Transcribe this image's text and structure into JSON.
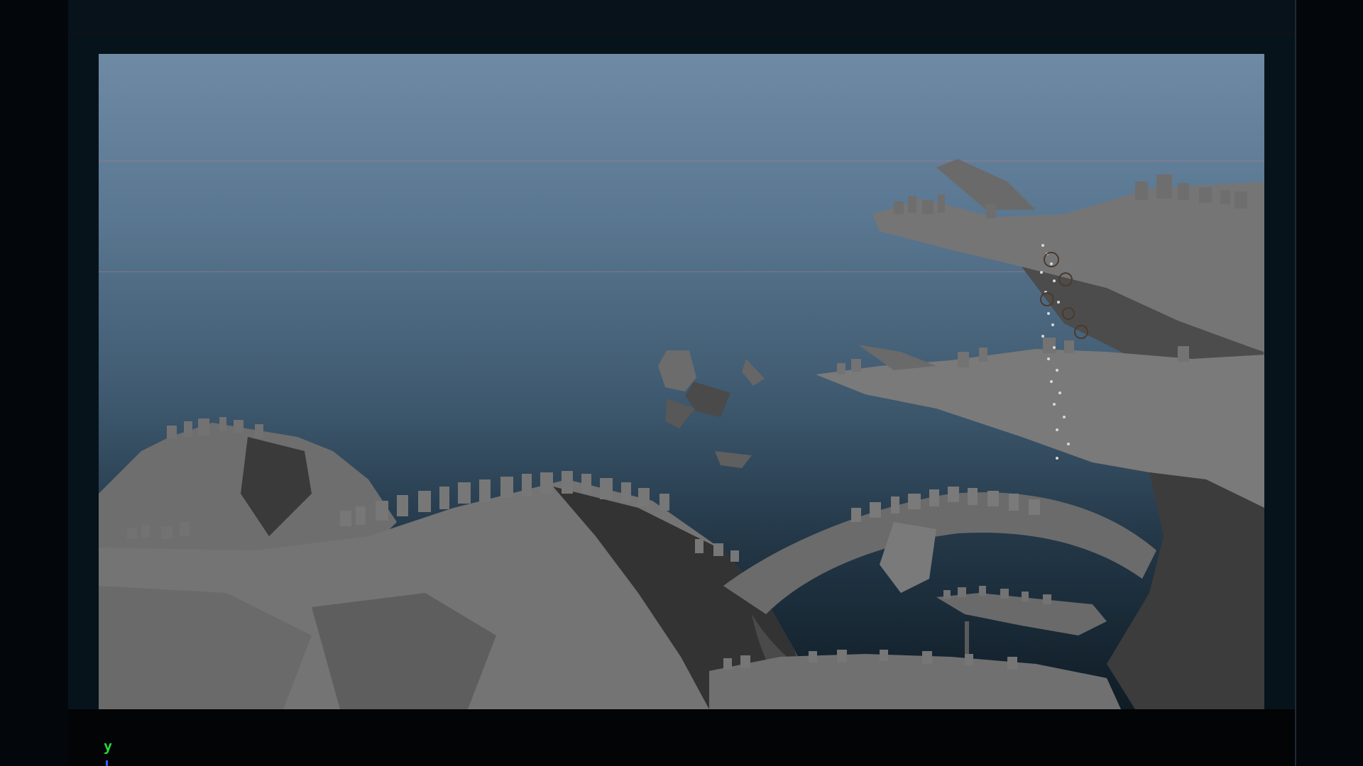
{
  "viewport": {
    "axis_labels": {
      "y": "y"
    },
    "colors": {
      "sky_top": "#6e8aa4",
      "sky_bottom": "#0f1c25",
      "rock": "#6f6f6f",
      "axis_y": "#27d83a",
      "axis_z": "#3c5cff"
    },
    "scene_objects": [
      "floating-rock-islands",
      "cube-structures",
      "particle-stream"
    ]
  }
}
